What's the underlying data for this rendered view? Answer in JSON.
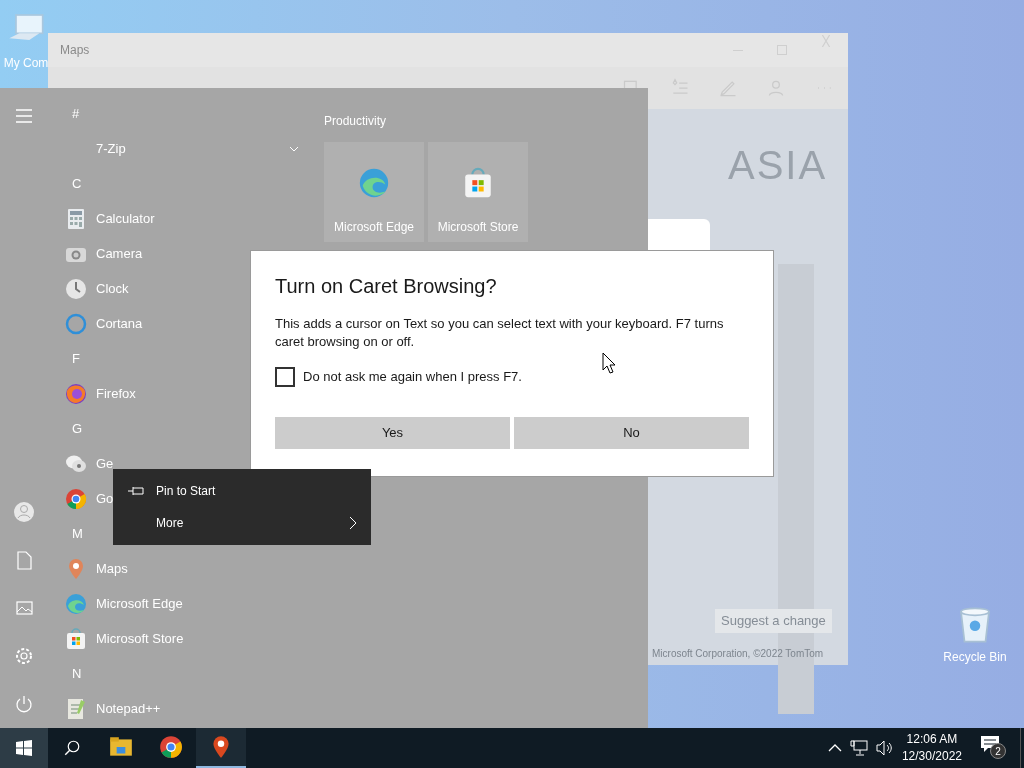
{
  "desktop_icons": [
    {
      "label": "My Com"
    },
    {
      "label": "Recycle Bin"
    }
  ],
  "maps_window": {
    "title": "Maps",
    "map_label": "ASIA",
    "suggest_button": "Suggest a change",
    "footer": "Microsoft Corporation, ©2022 TomTom"
  },
  "start_menu": {
    "apps": [
      {
        "kind": "header",
        "label": "#"
      },
      {
        "kind": "folder",
        "label": "7-Zip",
        "expanded": false
      },
      {
        "kind": "header",
        "label": "C"
      },
      {
        "kind": "app",
        "label": "Calculator"
      },
      {
        "kind": "app",
        "label": "Camera"
      },
      {
        "kind": "app",
        "label": "Clock"
      },
      {
        "kind": "app",
        "label": "Cortana"
      },
      {
        "kind": "header",
        "label": "F"
      },
      {
        "kind": "app",
        "label": "Firefox"
      },
      {
        "kind": "header",
        "label": "G"
      },
      {
        "kind": "app",
        "label": "Ge"
      },
      {
        "kind": "app",
        "label": "Go"
      },
      {
        "kind": "header",
        "label": "M"
      },
      {
        "kind": "app",
        "label": "Maps"
      },
      {
        "kind": "app",
        "label": "Microsoft Edge"
      },
      {
        "kind": "app",
        "label": "Microsoft Store"
      },
      {
        "kind": "header",
        "label": "N"
      },
      {
        "kind": "app",
        "label": "Notepad++"
      }
    ],
    "tile_group": {
      "title": "Productivity",
      "tiles": [
        {
          "label": "Microsoft Edge"
        },
        {
          "label": "Microsoft Store"
        }
      ]
    }
  },
  "context_menu": {
    "items": [
      {
        "kind": "pin",
        "label": "Pin to Start"
      },
      {
        "kind": "submenu",
        "label": "More"
      }
    ]
  },
  "dialog": {
    "title": "Turn on Caret Browsing?",
    "message": "This adds a cursor on Text so you can select text with your keyboard. F7 turns caret browsing on or off.",
    "checkbox": {
      "label": "Do not ask me again when I press F7.",
      "checked": false
    },
    "buttons": [
      "Yes",
      "No"
    ]
  },
  "taskbar": {
    "start_open": true,
    "apps": [
      {
        "active": false
      },
      {
        "active": false
      },
      {
        "active": true
      }
    ],
    "time": "12:06 AM",
    "date": "12/30/2022",
    "notifications": "2"
  }
}
